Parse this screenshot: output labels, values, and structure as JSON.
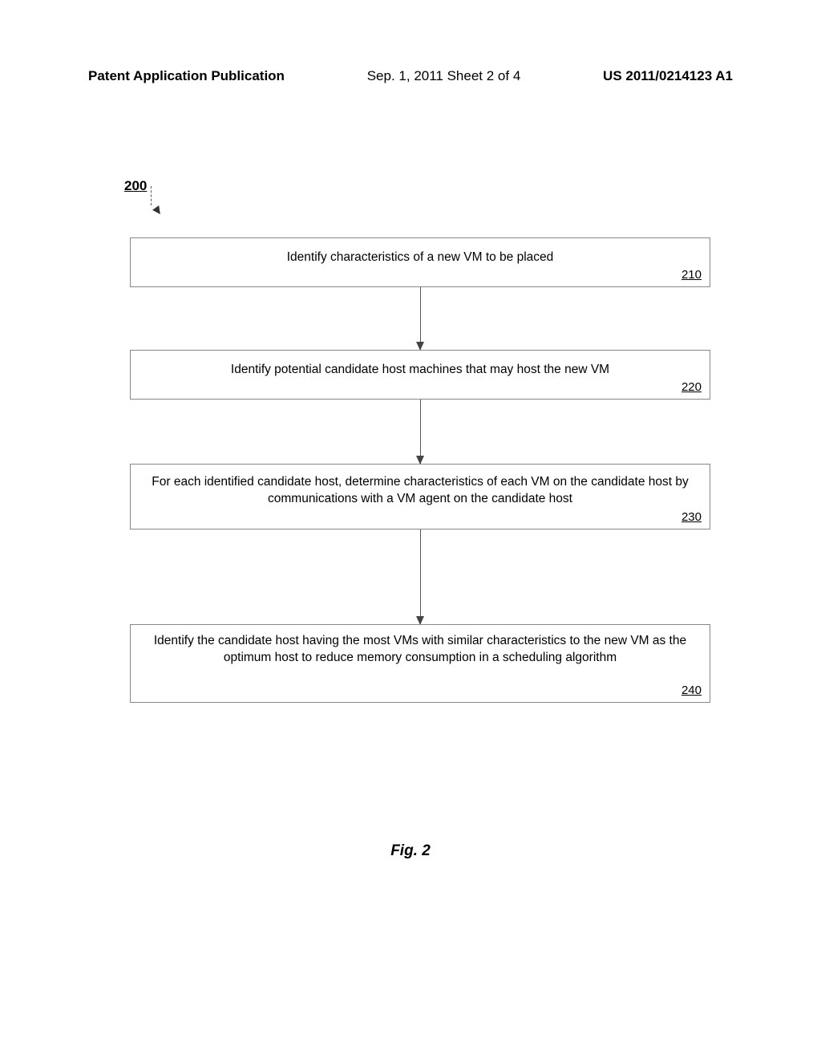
{
  "header": {
    "left": "Patent Application Publication",
    "center": "Sep. 1, 2011  Sheet 2 of 4",
    "right": "US 2011/0214123 A1"
  },
  "diagram_label": "200",
  "chart_data": {
    "type": "flowchart",
    "title": "Fig. 2",
    "nodes": [
      {
        "id": "210",
        "text": "Identify characteristics of a new VM to be placed",
        "ref": "210"
      },
      {
        "id": "220",
        "text": "Identify potential candidate host machines that may host the new VM",
        "ref": "220"
      },
      {
        "id": "230",
        "text": "For each identified candidate host, determine characteristics of each VM on the candidate host by communications with a VM agent on the candidate host",
        "ref": "230"
      },
      {
        "id": "240",
        "text": "Identify the candidate host having the most VMs with similar characteristics to the new VM as the optimum host to reduce memory consumption in a scheduling algorithm",
        "ref": "240"
      }
    ],
    "edges": [
      {
        "from": "210",
        "to": "220"
      },
      {
        "from": "220",
        "to": "230"
      },
      {
        "from": "230",
        "to": "240"
      }
    ]
  },
  "figure_label": "Fig. 2"
}
